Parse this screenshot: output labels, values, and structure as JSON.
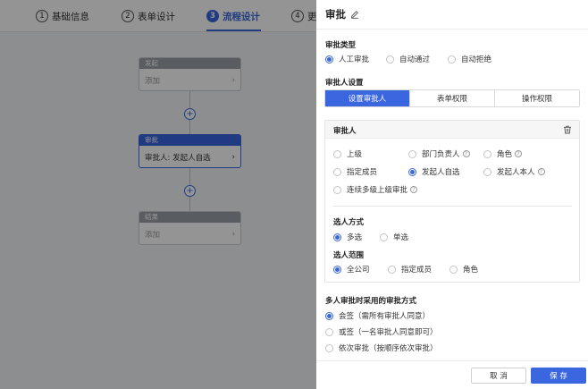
{
  "steps": [
    {
      "num": "1",
      "label": "基础信息"
    },
    {
      "num": "2",
      "label": "表单设计"
    },
    {
      "num": "3",
      "label": "流程设计"
    },
    {
      "num": "4",
      "label": "更"
    }
  ],
  "flow": {
    "start": {
      "title": "发起",
      "body": "添加"
    },
    "approval": {
      "title": "审批",
      "body": "审批人: 发起人自选"
    },
    "end": {
      "title": "结果",
      "body": "添加"
    },
    "plus": "+",
    "chevron": "›"
  },
  "drawer": {
    "title": "审批",
    "approval_type": {
      "title": "审批类型",
      "options": [
        "人工审批",
        "自动通过",
        "自动拒绝"
      ],
      "selected": 0
    },
    "approver_settings": {
      "title": "审批人设置",
      "tabs": [
        "设置审批人",
        "表单权限",
        "操作权限"
      ],
      "active_tab": 0
    },
    "approver_box": {
      "title": "审批人",
      "options": [
        "上级",
        "部门负责人",
        "角色",
        "指定成员",
        "发起人自选",
        "发起人本人",
        "连续多级上级审批"
      ],
      "selected": 4,
      "help_mark": "?"
    },
    "pick_mode": {
      "title": "选人方式",
      "options": [
        "多选",
        "单选"
      ],
      "selected": 0
    },
    "pick_scope": {
      "title": "选人范围",
      "options": [
        "全公司",
        "指定成员",
        "角色"
      ],
      "selected": 0
    },
    "multi_mode": {
      "title": "多人审批时采用的审批方式",
      "options": [
        "会签（需所有审批人同意）",
        "或签（一名审批人同意即可）",
        "依次审批（按顺序依次审批）"
      ],
      "selected": 0
    },
    "footer": {
      "cancel": "取 消",
      "save": "保 存"
    }
  },
  "colors": {
    "accent": "#3a67e0",
    "node_header": "#9aa0a8"
  },
  "icons": {
    "edit": "edit-icon",
    "delete": "trash-icon"
  }
}
